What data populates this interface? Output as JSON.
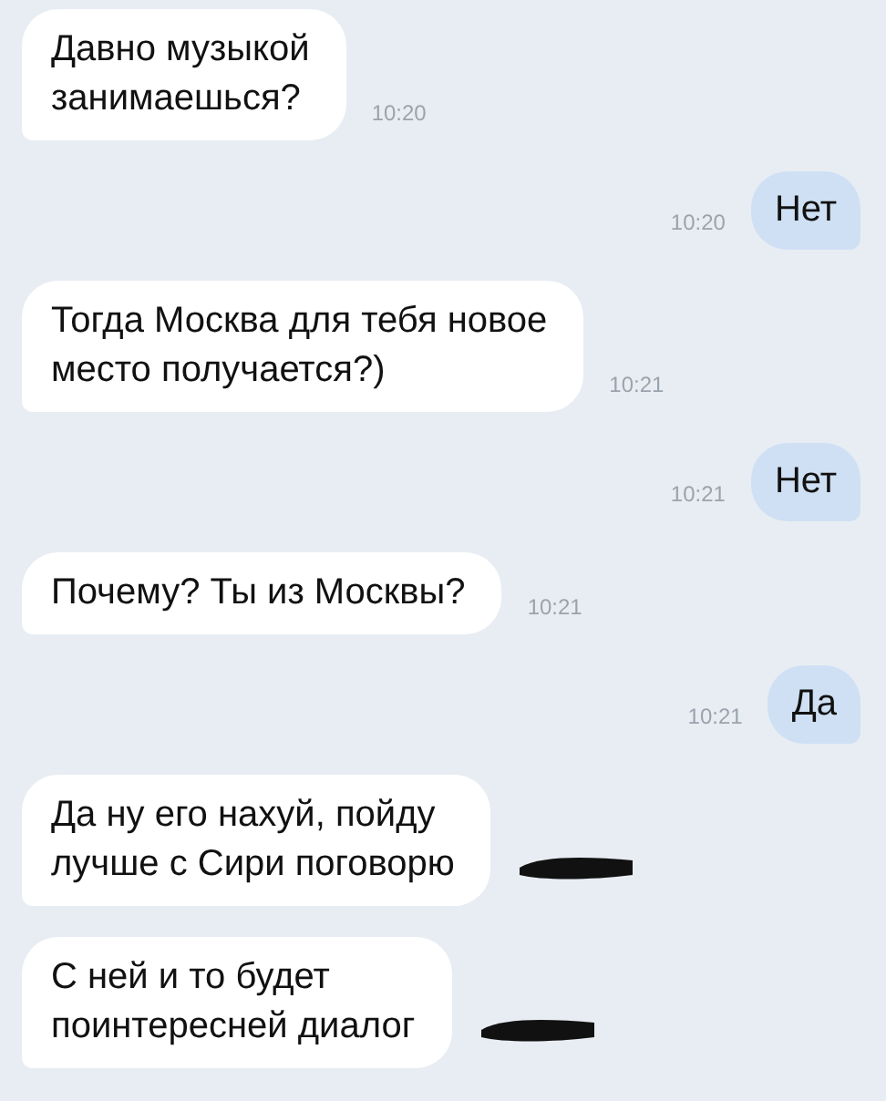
{
  "messages": [
    {
      "kind": "in",
      "text": "Давно музыкой\nзанимаешься?",
      "time": "10:20",
      "time_hidden": false
    },
    {
      "kind": "out",
      "text": "Нет",
      "time": "10:20",
      "time_hidden": false
    },
    {
      "kind": "in",
      "text": "Тогда Москва для тебя новое\nместо получается?)",
      "time": "10:21",
      "time_hidden": false
    },
    {
      "kind": "out",
      "text": "Нет",
      "time": "10:21",
      "time_hidden": false
    },
    {
      "kind": "in",
      "text": "Почему? Ты из Москвы?",
      "time": "10:21",
      "time_hidden": false
    },
    {
      "kind": "out",
      "text": "Да",
      "time": "10:21",
      "time_hidden": false
    },
    {
      "kind": "in",
      "text": "Да ну его нахуй, пойду\nлучше с Сири поговорю",
      "time_hidden": true
    },
    {
      "kind": "in",
      "text": "С ней и то будет\nпоинтересней диалог",
      "time_hidden": true
    }
  ]
}
